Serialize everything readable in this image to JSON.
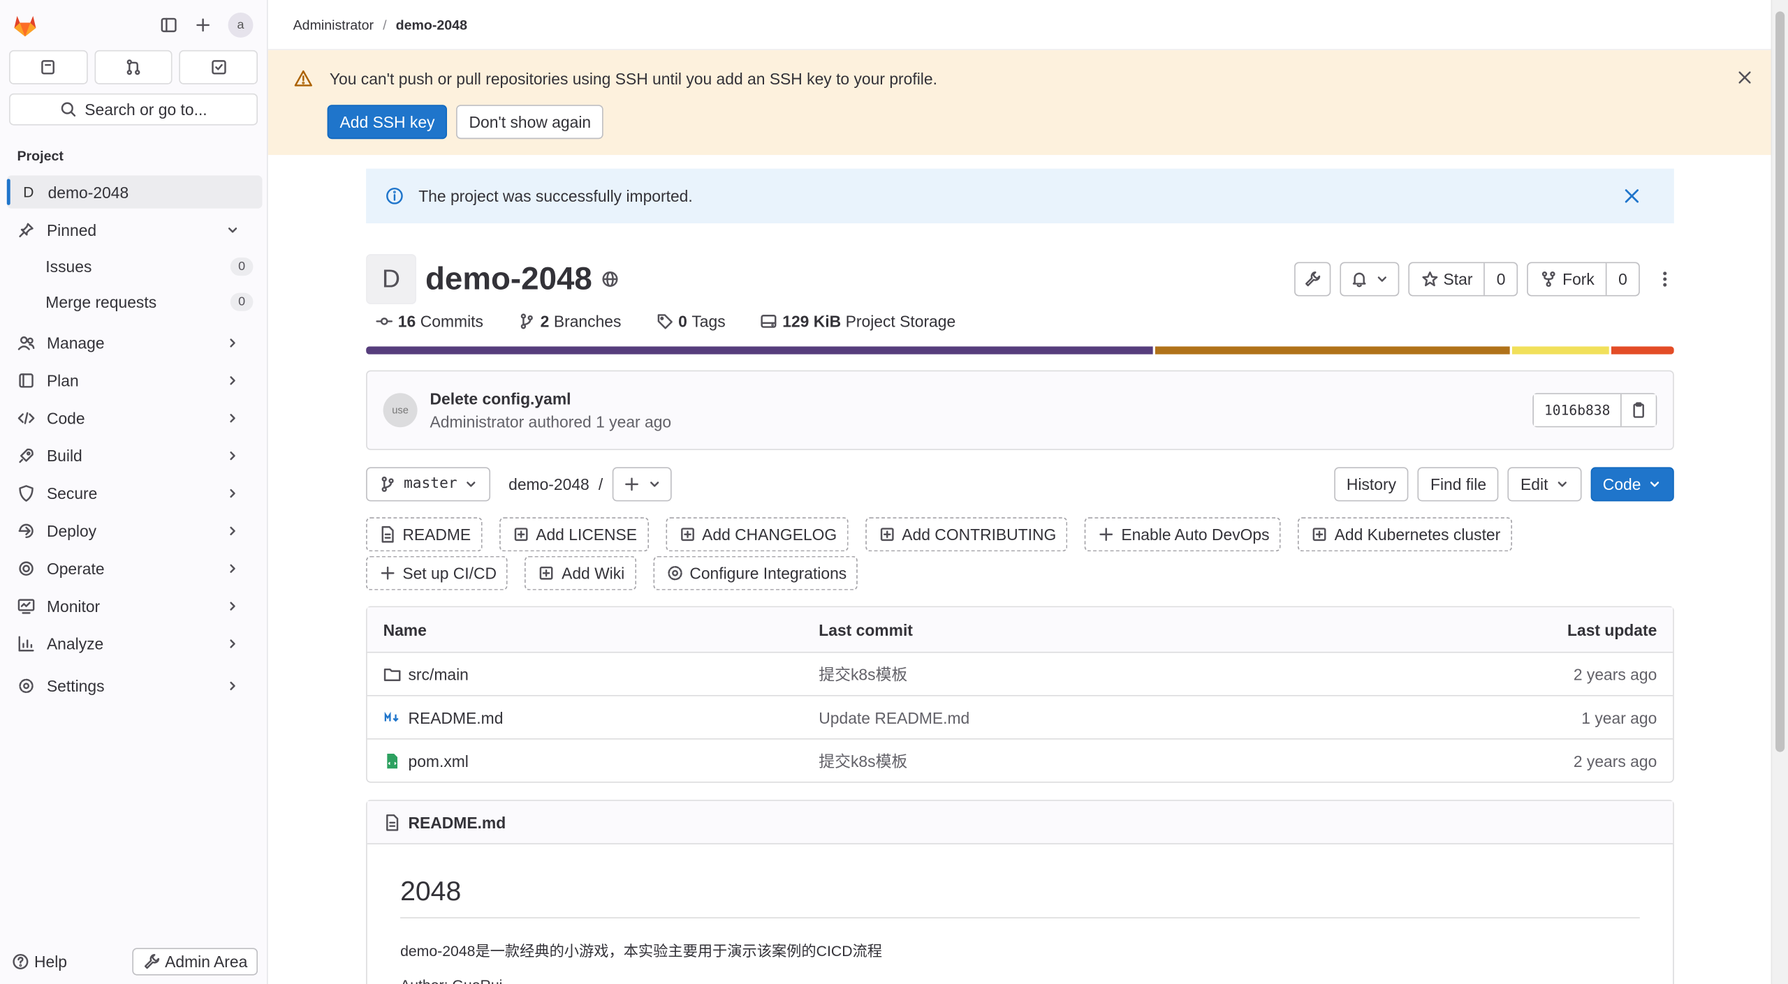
{
  "sidebar": {
    "search_label": "Search or go to...",
    "avatar_text": "a",
    "section_label": "Project",
    "project_initial": "D",
    "project_name": "demo-2048",
    "pinned_label": "Pinned",
    "pinned_items": [
      {
        "label": "Issues",
        "count": "0"
      },
      {
        "label": "Merge requests",
        "count": "0"
      }
    ],
    "nav_items": [
      "Manage",
      "Plan",
      "Code",
      "Build",
      "Secure",
      "Deploy",
      "Operate",
      "Monitor",
      "Analyze",
      "Settings"
    ],
    "help_label": "Help",
    "admin_label": "Admin Area"
  },
  "breadcrumb": {
    "parent": "Administrator",
    "current": "demo-2048"
  },
  "ssh_alert": {
    "message": "You can't push or pull repositories using SSH until you add an SSH key to your profile.",
    "primary_label": "Add SSH key",
    "secondary_label": "Don't show again"
  },
  "info_alert": {
    "message": "The project was successfully imported."
  },
  "project": {
    "initial": "D",
    "title": "demo-2048",
    "star_label": "Star",
    "star_count": "0",
    "fork_label": "Fork",
    "fork_count": "0",
    "stats": [
      {
        "value": "16",
        "label": "Commits"
      },
      {
        "value": "2",
        "label": "Branches"
      },
      {
        "value": "0",
        "label": "Tags"
      },
      {
        "value": "129 KiB",
        "label": "Project Storage"
      }
    ],
    "languages": [
      {
        "color": "#563d7c",
        "share": 60.5
      },
      {
        "color": "#b07219",
        "share": 27.2
      },
      {
        "color": "#f1e05a",
        "share": 7.5
      },
      {
        "color": "#e34c26",
        "share": 4.8
      }
    ]
  },
  "commit": {
    "avatar_text": "use",
    "title": "Delete config.yaml",
    "author_line": "Administrator authored 1 year ago",
    "sha": "1016b838"
  },
  "repo_bar": {
    "branch": "master",
    "path": "demo-2048",
    "path_sep": "/",
    "history_label": "History",
    "find_file_label": "Find file",
    "edit_label": "Edit",
    "code_label": "Code"
  },
  "shortcuts": [
    {
      "label": "README",
      "icon": "file-icon"
    },
    {
      "label": "Add LICENSE",
      "icon": "plus-square-icon"
    },
    {
      "label": "Add CHANGELOG",
      "icon": "plus-square-icon"
    },
    {
      "label": "Add CONTRIBUTING",
      "icon": "plus-square-icon"
    },
    {
      "label": "Enable Auto DevOps",
      "icon": "plus-icon"
    },
    {
      "label": "Add Kubernetes cluster",
      "icon": "plus-square-icon"
    },
    {
      "label": "Set up CI/CD",
      "icon": "plus-icon"
    },
    {
      "label": "Add Wiki",
      "icon": "plus-square-icon"
    },
    {
      "label": "Configure Integrations",
      "icon": "settings-icon"
    }
  ],
  "files": {
    "headers": [
      "Name",
      "Last commit",
      "Last update"
    ],
    "rows": [
      {
        "name": "src/main",
        "icon": "folder-icon",
        "commit": "提交k8s模板",
        "updated": "2 years ago"
      },
      {
        "name": "README.md",
        "icon": "markdown-icon",
        "commit": "Update README.md",
        "updated": "1 year ago"
      },
      {
        "name": "pom.xml",
        "icon": "xml-file-icon",
        "commit": "提交k8s模板",
        "updated": "2 years ago"
      }
    ]
  },
  "readme": {
    "filename": "README.md",
    "heading": "2048",
    "paragraph": "demo-2048是一款经典的小游戏，本实验主要用于演示该案例的CICD流程",
    "author_line": "Author:   GuoRui"
  }
}
